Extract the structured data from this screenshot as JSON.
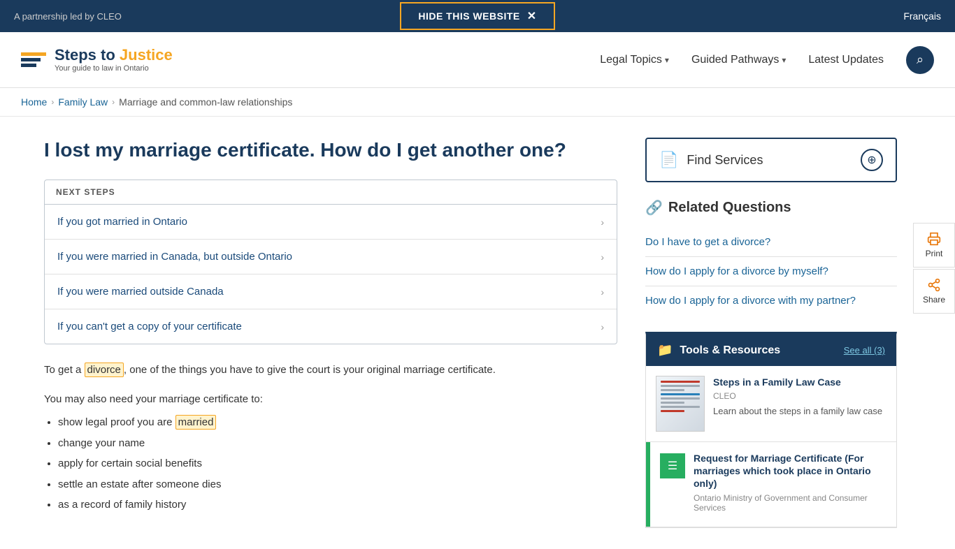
{
  "alert": {
    "partnership": "A partnership led by CLEO",
    "hide_btn": "HIDE THIS WEBSITE",
    "francais": "Français"
  },
  "header": {
    "logo_brand_part1": "Steps to",
    "logo_brand_part2": "Justice",
    "logo_tagline": "Your guide to law in Ontario",
    "nav_legal_topics": "Legal Topics",
    "nav_guided_pathways": "Guided Pathways",
    "nav_latest_updates": "Latest Updates"
  },
  "breadcrumb": {
    "home": "Home",
    "family_law": "Family Law",
    "current": "Marriage and common-law relationships"
  },
  "content": {
    "title": "I lost my marriage certificate. How do I get another one?",
    "next_steps_label": "NEXT STEPS",
    "steps": [
      "If you got married in Ontario",
      "If you were married in Canada, but outside Ontario",
      "If you were married outside Canada",
      "If you can't get a copy of your certificate"
    ],
    "para1_before": "To get a ",
    "para1_highlight": "divorce",
    "para1_after": ", one of the things you have to give the court is your original marriage certificate.",
    "para2": "You may also need your marriage certificate to:",
    "bullets": [
      "show legal proof you are married",
      "change your name",
      "apply for certain social benefits",
      "settle an estate after someone dies",
      "as a record of family history"
    ],
    "married_highlight": "married"
  },
  "sidebar": {
    "find_services_label": "Find Services",
    "related_title": "Related Questions",
    "related_questions": [
      "Do I have to get a divorce?",
      "How do I apply for a divorce by myself?",
      "How do I apply for a divorce with my partner?"
    ],
    "tools_title": "Tools & Resources",
    "tools_see_all": "See all (3)",
    "resource1": {
      "title": "Steps in a Family Law Case",
      "source": "CLEO",
      "desc": "Learn about the steps in a family law case"
    },
    "resource2": {
      "title": "Request for Marriage Certificate (For marriages which took place in Ontario only)",
      "source": "Ontario Ministry of Government and Consumer Services",
      "desc": ""
    }
  },
  "side_float": {
    "print_label": "Print",
    "share_label": "Share"
  }
}
